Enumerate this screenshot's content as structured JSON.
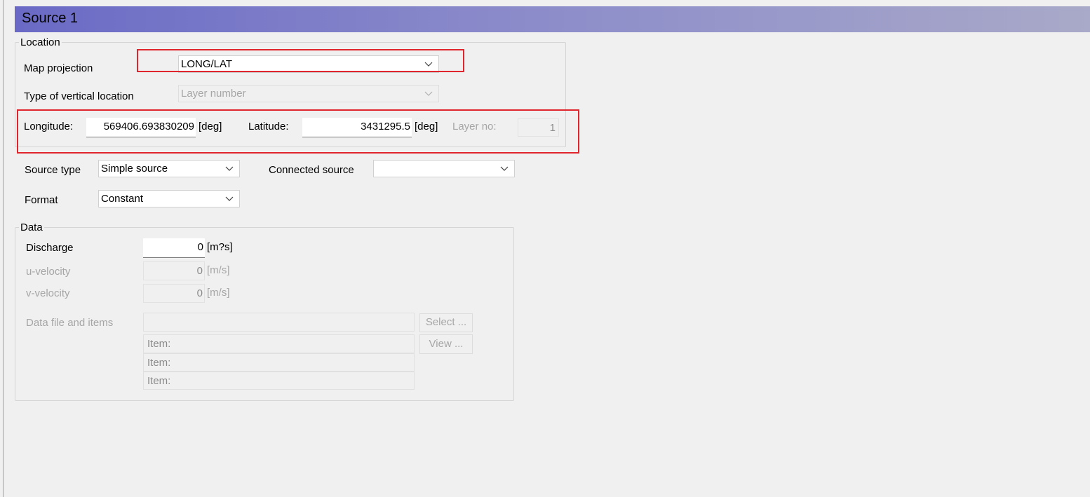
{
  "title": "Source 1",
  "location": {
    "group_label": "Location",
    "map_projection": {
      "label": "Map projection",
      "value": "LONG/LAT"
    },
    "vertical_location": {
      "label": "Type of vertical location",
      "value": "Layer number"
    },
    "longitude": {
      "label": "Longitude:",
      "value": "569406.693830209",
      "unit": "[deg]"
    },
    "latitude": {
      "label": "Latitude:",
      "value": "3431295.5",
      "unit": "[deg]"
    },
    "layer_no": {
      "label": "Layer no:",
      "value": "1"
    }
  },
  "source_type": {
    "label": "Source type",
    "value": "Simple source"
  },
  "connected_source": {
    "label": "Connected source",
    "value": ""
  },
  "format": {
    "label": "Format",
    "value": "Constant"
  },
  "data": {
    "group_label": "Data",
    "discharge": {
      "label": "Discharge",
      "value": "0",
      "unit": "[m?s]"
    },
    "u_velocity": {
      "label": "u-velocity",
      "value": "0",
      "unit": "[m/s]"
    },
    "v_velocity": {
      "label": "v-velocity",
      "value": "0",
      "unit": "[m/s]"
    },
    "data_file": {
      "label": "Data file and items",
      "value": ""
    },
    "items": [
      "Item:",
      "Item:",
      "Item:"
    ],
    "select_button": "Select ...",
    "view_button": "View ..."
  },
  "colors": {
    "highlight": "#e0252d",
    "title_start": "#6a6ac6",
    "title_end": "#a9a9c9"
  }
}
